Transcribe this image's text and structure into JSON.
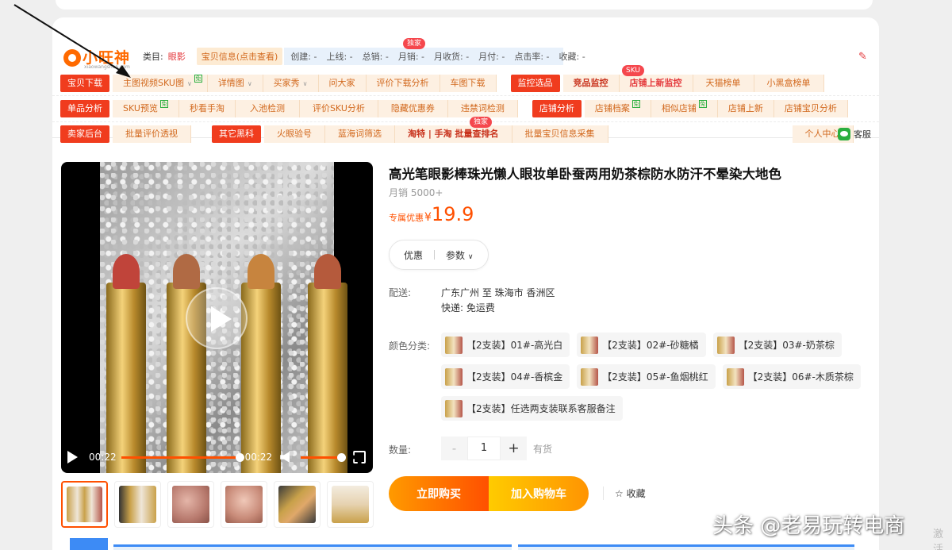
{
  "plugin": {
    "logo_text": "小旺神",
    "logo_sub": "xiaowangshen.com",
    "category_label": "类目:",
    "category_value": "眼影",
    "info_link": "宝贝信息(点击查看)",
    "stats": [
      "创建: -",
      "上线: -",
      "总销: -",
      "月销: -",
      "月收货: -",
      "月付: -",
      "点击率: -",
      "收藏: -"
    ],
    "exclusive_badge": "独家",
    "sku_badge": "SKU",
    "row1": {
      "tag": "宝贝下载",
      "items": [
        "主图视频SKU图",
        "详情图",
        "买家秀",
        "问大家",
        "评价下载分析",
        "车图下载"
      ],
      "tag2": "监控选品",
      "items2": [
        "竞品监控",
        "店铺上新监控",
        "天猫榜单",
        "小黑盒榜单"
      ]
    },
    "row2": {
      "tag": "单品分析",
      "items": [
        "SKU预览",
        "秒看手淘",
        "入池检测",
        "评价SKU分析",
        "隐藏优惠券",
        "违禁词检测"
      ],
      "tag2": "店铺分析",
      "items2": [
        "店铺档案",
        "相似店铺",
        "店铺上新",
        "店铺宝贝分析"
      ]
    },
    "row3": {
      "tag": "卖家后台",
      "items": [
        "批量评价透视"
      ],
      "tag2": "其它黑科",
      "items2": [
        "火眼验号",
        "蓝海词筛选",
        "淘特 | 手淘 批量查排名",
        "批量宝贝信息采集"
      ],
      "personal": "个人中心"
    },
    "kefu": "客服"
  },
  "video": {
    "time_current": "00:22",
    "time_total": "00:22",
    "progress": 1.0,
    "volume": 1.0
  },
  "product": {
    "title": "高光笔眼影棒珠光懒人眼妆单卧蚕两用奶茶棕防水防汗不晕染大地色",
    "sales": "月销 5000+",
    "price_label": "专属优惠",
    "currency": "¥",
    "price": "19.9",
    "tab_discount": "优惠",
    "tab_params": "参数",
    "shipping_label": "配送:",
    "shipping_route": "广东广州 至 珠海市 香洲区",
    "shipping_fee": "快递: 免运费",
    "color_label": "颜色分类:",
    "skus": [
      "【2支装】01#-高光白",
      "【2支装】02#-砂糖橘",
      "【2支装】03#-奶茶棕",
      "【2支装】04#-香槟金",
      "【2支装】05#-鱼烟桃红",
      "【2支装】06#-木质茶棕",
      "【2支装】任选两支装联系客服备注"
    ],
    "qty_label": "数量:",
    "qty_minus": "-",
    "qty_value": "1",
    "qty_plus": "+",
    "stock": "有货",
    "buy_now": "立即购买",
    "add_cart": "加入购物车",
    "favorite": "☆ 收藏"
  },
  "watermark": "头条 @老易玩转电商",
  "activate_text": "激活"
}
